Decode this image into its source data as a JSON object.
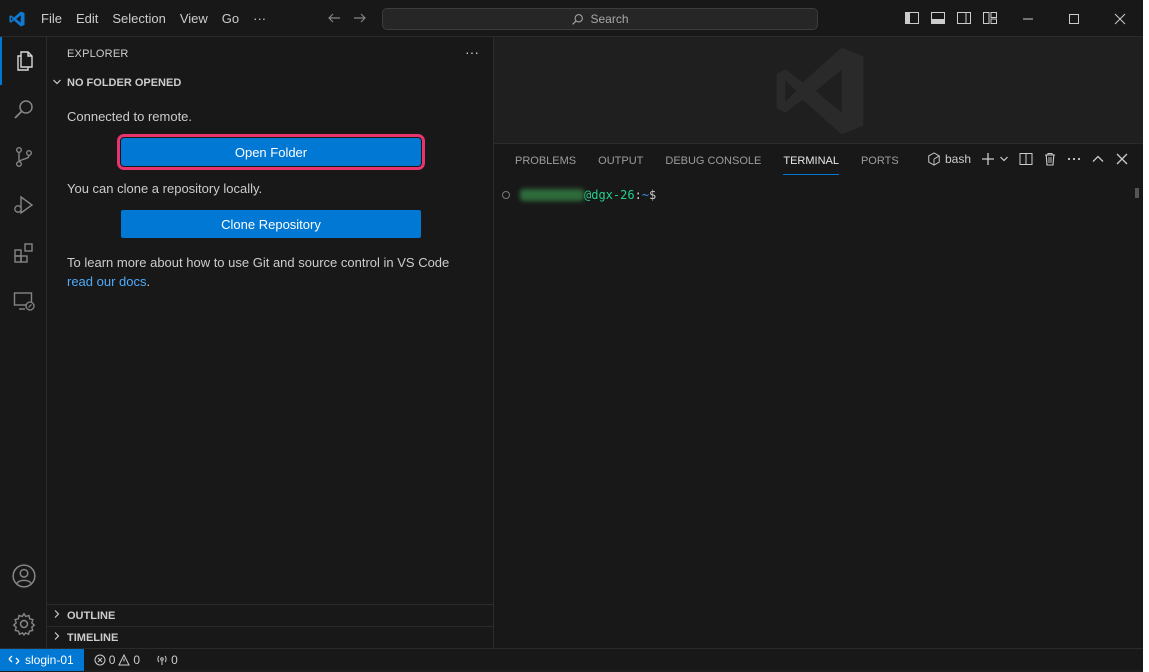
{
  "titlebar": {
    "menu": [
      "File",
      "Edit",
      "Selection",
      "View",
      "Go",
      "···"
    ],
    "search_placeholder": "Search"
  },
  "sidebar": {
    "title": "EXPLORER",
    "more": "···",
    "no_folder_header": "NO FOLDER OPENED",
    "connected_text": "Connected to remote.",
    "open_folder_label": "Open Folder",
    "clone_text": "You can clone a repository locally.",
    "clone_label": "Clone Repository",
    "learn_text": "To learn more about how to use Git and source control in VS Code",
    "docs_link": "read our docs",
    "docs_suffix": ".",
    "outline_header": "OUTLINE",
    "timeline_header": "TIMELINE"
  },
  "panel": {
    "tabs": [
      "PROBLEMS",
      "OUTPUT",
      "DEBUG CONSOLE",
      "TERMINAL",
      "PORTS"
    ],
    "active_tab": "TERMINAL",
    "shell_label": "bash"
  },
  "terminal": {
    "host": "@dgx-26",
    "sep": ":",
    "path": "~",
    "prompt": "$"
  },
  "statusbar": {
    "remote_label": "slogin-01",
    "errors": "0",
    "warnings": "0",
    "ports": "0"
  },
  "colors": {
    "accent": "#0078d4",
    "highlight_outline": "#e8336d",
    "link": "#4daafc",
    "terminal_host": "#23d18b",
    "terminal_path": "#3b8eea"
  }
}
